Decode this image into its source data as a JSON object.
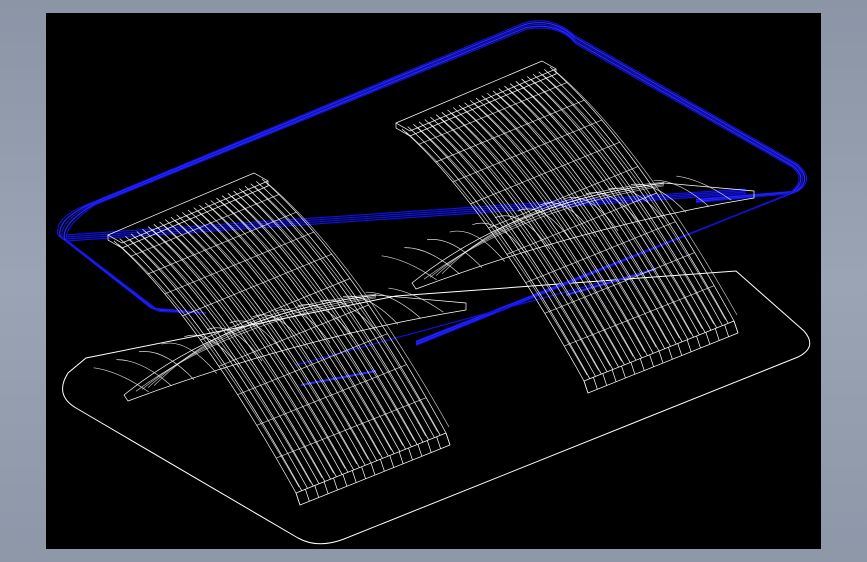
{
  "viewport": {
    "background": "#000000",
    "colors": {
      "frame": "#1010d8",
      "frame_bright": "#2a2aff",
      "wireframe": "#ffffff",
      "outline": "#ffffff"
    }
  },
  "model": {
    "benches": 2,
    "frame_rails": 5
  }
}
